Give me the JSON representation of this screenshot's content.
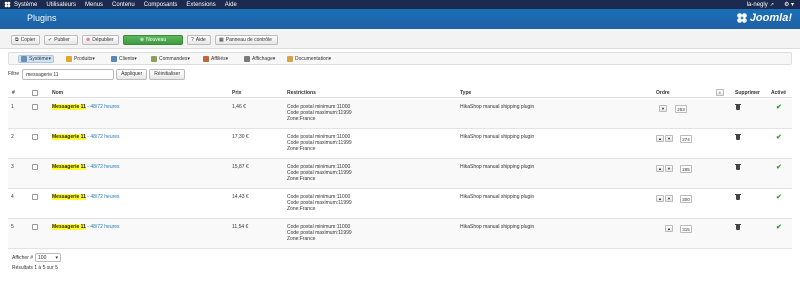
{
  "topbar": {
    "menu": [
      "Système",
      "Utilisateurs",
      "Menus",
      "Contenu",
      "Composants",
      "Extensions",
      "Aide"
    ],
    "user": "la-negly",
    "external_icon": "external-link-icon",
    "settings_icon": "gear-icon"
  },
  "header": {
    "title": "Plugins",
    "brand": "Joomla!"
  },
  "toolbar": {
    "copy": "Copier",
    "publish": "Publier",
    "unpublish": "Dépublier",
    "new": "Nouveau",
    "help": "Aide",
    "control_panel": "Panneau de contrôle"
  },
  "submenu": [
    "Système",
    "Produits",
    "Clients",
    "Commandes",
    "Affiliés",
    "Affichage",
    "Documentation"
  ],
  "filter": {
    "label": "Filtre",
    "value": "messagerie 11",
    "apply": "Appliquer",
    "reset": "Réinitialiser"
  },
  "table": {
    "headers": {
      "num": "#",
      "name": "Nom",
      "price": "Prix",
      "restrictions": "Restrictions",
      "type": "Type",
      "order": "Ordre",
      "delete": "Supprimer",
      "active": "Activé"
    },
    "rows": [
      {
        "num": "1",
        "name_hl": "Messagerie 11",
        "name_rest": " - 48/72 heures",
        "price": "1,46 €",
        "r1": "Code postal minimum:11000",
        "r2": "Code postal maximum:11999",
        "r3": "Zone:France",
        "type": "HikaShop manual shipping plugin",
        "order": "253"
      },
      {
        "num": "2",
        "name_hl": "Messagerie 11",
        "name_rest": " - 48/72 heures",
        "price": "17,30 €",
        "r1": "Code postal minimum:11000",
        "r2": "Code postal maximum:11999",
        "r3": "Zone:France",
        "type": "HikaShop manual shipping plugin",
        "order": "274"
      },
      {
        "num": "3",
        "name_hl": "Messagerie 11",
        "name_rest": " - 48/72 heures",
        "price": "15,87 €",
        "r1": "Code postal minimum:11000",
        "r2": "Code postal maximum:11999",
        "r3": "Zone:France",
        "type": "HikaShop manual shipping plugin",
        "order": "285"
      },
      {
        "num": "4",
        "name_hl": "Messagerie 11",
        "name_rest": " - 48/72 heures",
        "price": "14,43 €",
        "r1": "Code postal minimum:11000",
        "r2": "Code postal maximum:11999",
        "r3": "Zone:France",
        "type": "HikaShop manual shipping plugin",
        "order": "300"
      },
      {
        "num": "5",
        "name_hl": "Messagerie 11",
        "name_rest": " - 48/72 heures",
        "price": "11,54 €",
        "r1": "Code postal minimum:11000",
        "r2": "Code postal maximum:11999",
        "r3": "Zone:France",
        "type": "HikaShop manual shipping plugin",
        "order": "315"
      }
    ]
  },
  "footer": {
    "show_label": "Afficher #",
    "show_value": "100",
    "results": "Résultats 1 à 5 sur 5"
  },
  "colors": {
    "topbar": "#1b2a4e",
    "titlebar": "#1f66ab",
    "highlight": "#ffff33",
    "link": "#2a7ab8",
    "active_check": "#3b9b3b",
    "new_button": "#4cae4c"
  }
}
